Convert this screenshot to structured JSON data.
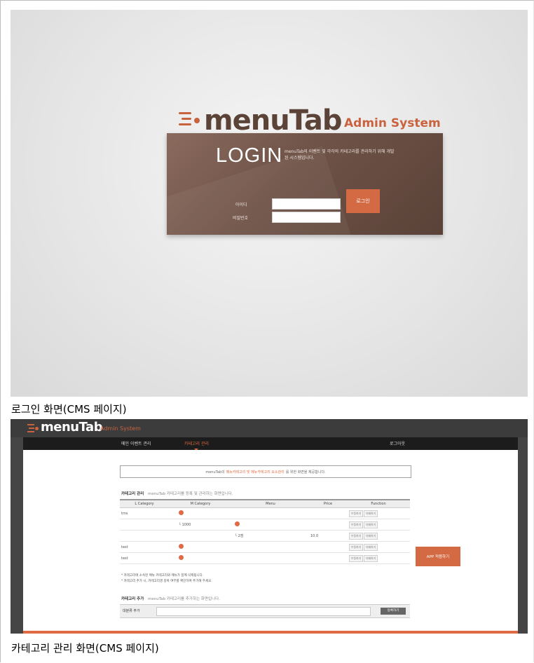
{
  "login_screen": {
    "logo": {
      "wordmark": "menuTab",
      "subtitle": "Admin System"
    },
    "title": "LOGIN",
    "description": "menuTab의 이벤트 및 각각의 카테고리를 관리하기 위해 개발된 시스템입니다.",
    "id_label": "아이디",
    "password_label": "비밀번호",
    "id_value": "",
    "password_value": "",
    "submit_label": "로그인"
  },
  "caption1": "로그인 화면(CMS 페이지)",
  "category_screen": {
    "logo": {
      "wordmark": "menuTab",
      "subtitle": "Admin System"
    },
    "nav": [
      {
        "label": "메인 이벤트 관리"
      },
      {
        "label": "카테고리 관리"
      }
    ],
    "logout_label": "로그아웃",
    "notice": {
      "prefix": "menuTab의",
      "highlight": "메뉴카테고리 및 메뉴카테고리 요소관리",
      "suffix": "를 위한 화면을 제공합니다."
    },
    "list_section": {
      "title": "카테고리 관리",
      "desc": "menuTab 카테고리를 등록 및 관리하는 화면입니다."
    },
    "table": {
      "headers": [
        "L Category",
        "M Category",
        "Menu",
        "Price",
        "Function"
      ],
      "rows": [
        {
          "l": "tms",
          "m_dot": true,
          "m": "",
          "menu_dot": false,
          "menu": "",
          "price": ""
        },
        {
          "l": "",
          "m_dot": false,
          "m": "└ 1000",
          "menu_dot": true,
          "menu": "",
          "price": ""
        },
        {
          "l": "",
          "m_dot": false,
          "m": "",
          "menu_dot": false,
          "menu": "└ 2점",
          "price": "10.0"
        },
        {
          "l": "test",
          "m_dot": true,
          "m": "",
          "menu_dot": false,
          "menu": "",
          "price": ""
        },
        {
          "l": "test",
          "m_dot": true,
          "m": "",
          "menu_dot": false,
          "menu": "",
          "price": ""
        }
      ],
      "func_buttons": [
        "수정하기",
        "삭제하기"
      ]
    },
    "notes": [
      "* 카테고리에 소속된 메뉴 카테고리와 메뉴가 함께 삭제됩니다.",
      "* 카테고리 추가 시, 카테고리명 중복 여부를 확인하여 추가해 주세요."
    ],
    "app_button_label": "APP 적용하기",
    "add_section": {
      "title": "카테고리 추가",
      "desc": "menuTab 카테고리를 추가하는 화면입니다."
    },
    "add_row": {
      "label": "대분류 추가",
      "input_value": "",
      "button_label": "등록하기"
    }
  },
  "caption2": "카테고리 관리 화면(CMS 페이지)"
}
